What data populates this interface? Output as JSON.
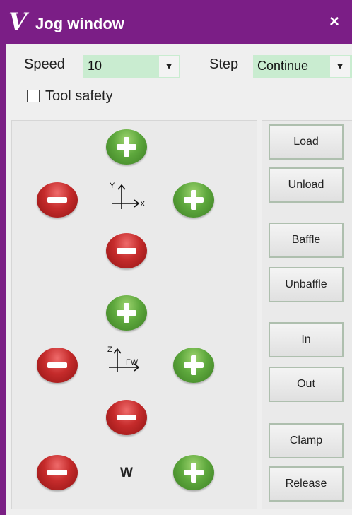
{
  "window": {
    "title": "Jog window",
    "logo": "V",
    "close_glyph": "×"
  },
  "controls": {
    "speed_label": "Speed",
    "speed_value": "10",
    "step_label": "Step",
    "step_value": "Continue",
    "dropdown_glyph": "▼",
    "tool_safety_label": "Tool safety",
    "tool_safety_checked": false
  },
  "jog": {
    "xy_axis": {
      "vertical": "Y",
      "horizontal": "X"
    },
    "zfw_axis": {
      "vertical": "Z",
      "horizontal": "FW"
    },
    "w_label": "W"
  },
  "side_buttons": {
    "load": "Load",
    "unload": "Unload",
    "baffle": "Baffle",
    "unbaffle": "Unbaffle",
    "in": "In",
    "out": "Out",
    "clamp": "Clamp",
    "release": "Release"
  },
  "colors": {
    "titlebar": "#7b1e86",
    "combo_bg": "#c9ecd0",
    "plus_button": "#5ea83d",
    "minus_button": "#c52b2b"
  }
}
